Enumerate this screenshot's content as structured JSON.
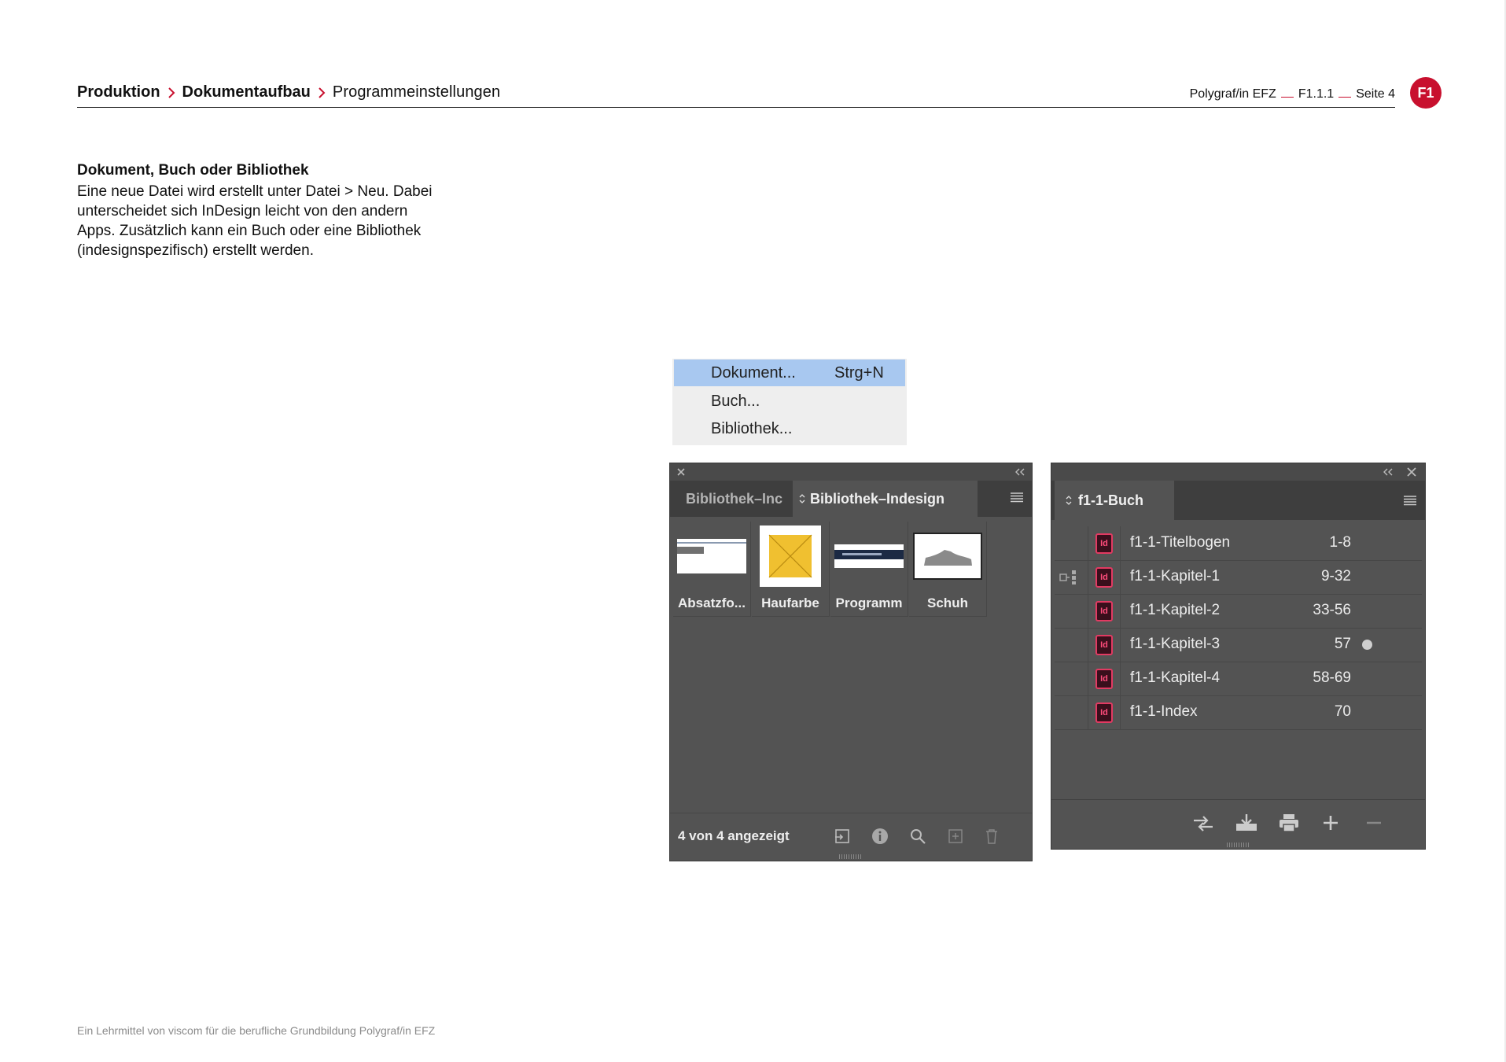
{
  "header": {
    "breadcrumb": [
      "Produktion",
      "Dokumentaufbau",
      "Programmeinstellungen"
    ],
    "course": "Polygraf/in EFZ",
    "section_code": "F1.1.1",
    "page": "Seite 4",
    "badge": "F1",
    "accent_color": "#c8102e"
  },
  "intro": {
    "title": "Dokument, Buch oder Bibliothek",
    "lines": [
      "Eine neue Datei wird erstellt unter Datei > Neu. Dabei",
      "unterscheidet sich InDesign leicht von den andern",
      "Apps. Zusätzlich kann ein Buch oder eine Bibliothek",
      "(indesignspezifisch) erstellt werden."
    ]
  },
  "menu": {
    "items": [
      {
        "label": "Dokument...",
        "shortcut": "Strg+N",
        "active": true
      },
      {
        "label": "Buch...",
        "shortcut": "",
        "active": false
      },
      {
        "label": "Bibliothek...",
        "shortcut": "",
        "active": false
      }
    ]
  },
  "library_panel": {
    "tabs": [
      "Bibliothek–Inc",
      "Bibliothek–Indesign"
    ],
    "items": [
      {
        "label": "Absatzfo..."
      },
      {
        "label": "Haufarbe"
      },
      {
        "label": "Programm"
      },
      {
        "label": "Schuh"
      }
    ],
    "count": "4 von 4 angezeigt",
    "swatch_color": "#f0c030"
  },
  "book_panel": {
    "title": "f1-1-Buch",
    "rows": [
      {
        "name": "f1-1-Titelbogen",
        "pages": "1-8",
        "sync_source": false,
        "status": false
      },
      {
        "name": "f1-1-Kapitel-1",
        "pages": "9-32",
        "sync_source": true,
        "status": false
      },
      {
        "name": "f1-1-Kapitel-2",
        "pages": "33-56",
        "sync_source": false,
        "status": false
      },
      {
        "name": "f1-1-Kapitel-3",
        "pages": "57",
        "sync_source": false,
        "status": true
      },
      {
        "name": "f1-1-Kapitel-4",
        "pages": "58-69",
        "sync_source": false,
        "status": false
      },
      {
        "name": "f1-1-Index",
        "pages": "70",
        "sync_source": false,
        "status": false
      }
    ],
    "id_icon_text": "Id"
  },
  "footer": {
    "note": "Ein Lehrmittel von viscom für die berufliche Grundbildung Polygraf/in EFZ"
  }
}
